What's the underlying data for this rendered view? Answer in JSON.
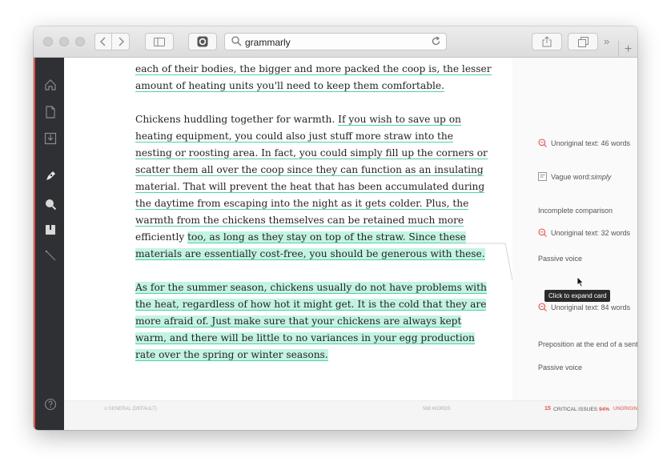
{
  "browser": {
    "url": "grammarly"
  },
  "paragraphs": {
    "p1": [
      "each of their bodies, the bigger and more packed the coop is, the lesser",
      "amount of heating units you'll need to keep them comfortable."
    ],
    "p2": [
      "Chickens huddling together for warmth. ",
      "If you wish to save up on",
      "heating equipment, you could also just stuff more straw into the",
      "nesting or roosting area. In fact, you could simply fill up the corners or",
      "scatter them all over the coop since they can function as an insulating",
      "material. That will prevent the heat that has been accumulated during",
      "the daytime from escaping into the night as it gets colder. Plus, the",
      "warmth from the chickens themselves can be retained much more",
      "efficiently ",
      "too, as long as they stay on top of the straw. Since these",
      "materials are essentially cost-free, you should be generous with these."
    ],
    "p3": [
      "As for the summer season, chickens usually do not have problems with",
      "the heat, regardless of how hot it might get. It is the cold that they are",
      "more afraid of. Just make sure that your chickens are always kept",
      "warm, and there will be little to no variances in your egg production",
      "rate over the spring or winter seasons."
    ]
  },
  "cards": [
    {
      "icon": "plagiarism-icon",
      "label": "Unoriginal text: 46 words"
    },
    {
      "icon": "vague-word-icon",
      "label": "Vague word: ",
      "emph": "simply"
    },
    {
      "icon": "",
      "label": "Incomplete comparison"
    },
    {
      "icon": "plagiarism-icon",
      "label": "Unoriginal text: 32 words"
    },
    {
      "icon": "",
      "label": "Passive voice"
    },
    {
      "icon": "plagiarism-icon",
      "label": "Unoriginal text: 84 words"
    },
    {
      "icon": "",
      "label": "Preposition at the end of a sent"
    },
    {
      "icon": "",
      "label": "Passive voice"
    }
  ],
  "tooltip": "Click to expand card",
  "status": {
    "goals": "GENERAL (DEFAULT)",
    "words": "568 WORDS",
    "critical_count": "15",
    "critical_label": "CRITICAL ISSUES",
    "unoriginal_pct": "94%",
    "unoriginal_label": "UNORIGIN"
  },
  "colors": {
    "accent_red": "#e0524a",
    "highlight_green": "#c3f4e1",
    "underline_green": "#4fd1b0",
    "sidebar_bg": "#2f3033"
  }
}
